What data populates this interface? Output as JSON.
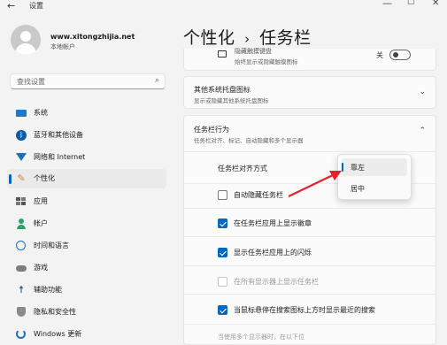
{
  "window": {
    "title": "设置",
    "back_icon": "back-arrow-icon",
    "minimize_symbol": "—",
    "maximize_symbol": "☐",
    "close_symbol": "✕"
  },
  "user": {
    "name": "www.xitongzhijia.net",
    "account_type": "本地帐户"
  },
  "search": {
    "placeholder": "查找设置",
    "icon": "search-icon"
  },
  "sidebar": {
    "items": [
      {
        "label": "系统",
        "icon": "monitor-icon",
        "selected": false
      },
      {
        "label": "蓝牙和其他设备",
        "icon": "bluetooth-icon",
        "selected": false
      },
      {
        "label": "网络和 Internet",
        "icon": "wifi-icon",
        "selected": false
      },
      {
        "label": "个性化",
        "icon": "brush-icon",
        "selected": true
      },
      {
        "label": "应用",
        "icon": "apps-icon",
        "selected": false
      },
      {
        "label": "帐户",
        "icon": "person-icon",
        "selected": false
      },
      {
        "label": "时间和语言",
        "icon": "globe-clock-icon",
        "selected": false
      },
      {
        "label": "游戏",
        "icon": "gamepad-icon",
        "selected": false
      },
      {
        "label": "辅助功能",
        "icon": "accessibility-icon",
        "selected": false
      },
      {
        "label": "隐私和安全性",
        "icon": "shield-icon",
        "selected": false
      },
      {
        "label": "Windows 更新",
        "icon": "update-icon",
        "selected": false
      }
    ]
  },
  "breadcrumb": {
    "parent": "个性化",
    "separator": "›",
    "current": "任务栏"
  },
  "partial_card": {
    "title": "隐藏触摸键盘",
    "subtitle": "始终显示或隐藏触摸图标",
    "toggle_label": "关",
    "toggle_on": false
  },
  "tray_card": {
    "title": "其他系统托盘图标",
    "subtitle": "显示或隐藏其他系统托盘图标"
  },
  "behaviors": {
    "title": "任务栏行为",
    "subtitle": "任务栏对齐、标记、自动隐藏和多个显示器",
    "alignment_label": "任务栏对齐方式",
    "options": [
      {
        "label": "自动隐藏任务栏",
        "state": "off"
      },
      {
        "label": "在任务栏应用上显示徽章",
        "state": "on"
      },
      {
        "label": "显示任务栏应用上的闪烁",
        "state": "on"
      },
      {
        "label": "在所有显示器上显示任务栏",
        "state": "disabled"
      },
      {
        "label": "当鼠标悬停在搜索图标上方时显示最近的搜索",
        "state": "on"
      }
    ],
    "footer_partial": "当使用多个显示器时，在以下位"
  },
  "alignment_dropdown": {
    "options": [
      {
        "label": "靠左",
        "selected": true
      },
      {
        "label": "居中",
        "selected": false
      }
    ]
  },
  "annotation": {
    "color": "#e0232f"
  },
  "colors": {
    "accent": "#0067c0",
    "background": "#f3f3f3",
    "card": "#fbfbfb"
  }
}
